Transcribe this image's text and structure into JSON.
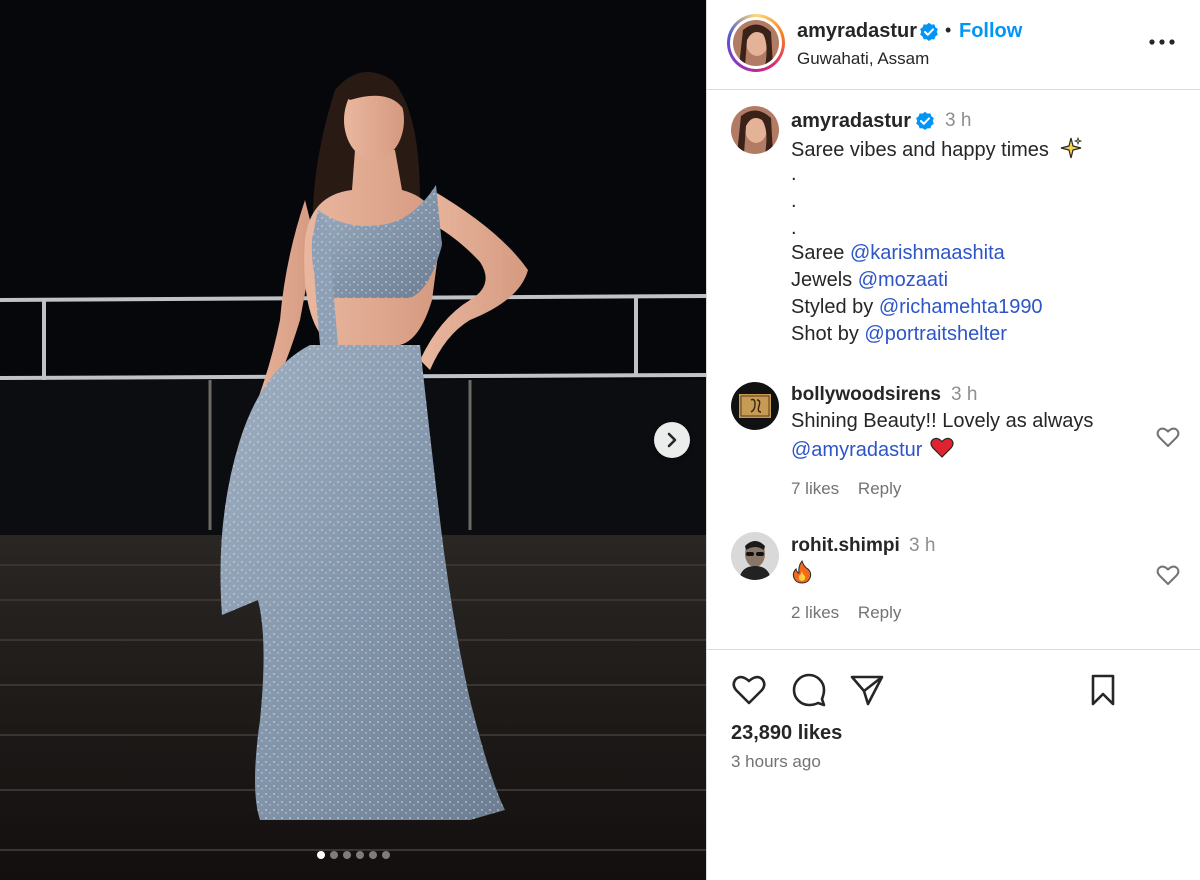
{
  "post": {
    "carousel_slides": 6,
    "carousel_index": 1
  },
  "header": {
    "username": "amyradastur",
    "follow_label": "Follow",
    "separator": "•",
    "location": "Guwahati, Assam",
    "more_icon": "more-horizontal-icon"
  },
  "caption": {
    "username": "amyradastur",
    "time": "3 h",
    "title_line": "Saree vibes and happy times",
    "emoji": "sparkles-icon",
    "dots": [
      ".",
      ".",
      "."
    ],
    "credits": [
      {
        "label": "Saree",
        "mention": "@karishmaashita"
      },
      {
        "label": "Jewels",
        "mention": "@mozaati"
      },
      {
        "label": "Styled by",
        "mention": "@richamehta1990"
      },
      {
        "label": "Shot by",
        "mention": "@portraitshelter"
      }
    ]
  },
  "comments": [
    {
      "username": "bollywoodsirens",
      "time": "3 h",
      "text_line1": "Shining Beauty!! Lovely as always",
      "mention": "@amyradastur",
      "emoji": "red-heart-icon",
      "likes": "7 likes",
      "reply": "Reply"
    },
    {
      "username": "rohit.shimpi",
      "time": "3 h",
      "emoji": "fire-icon",
      "likes": "2 likes",
      "reply": "Reply"
    }
  ],
  "footer": {
    "likes": "23,890 likes",
    "time_ago": "3 hours ago"
  },
  "colors": {
    "accent": "#0095f6",
    "mention": "#2d55c8",
    "verified": "#0095f6",
    "muted": "#8e8e8e"
  }
}
